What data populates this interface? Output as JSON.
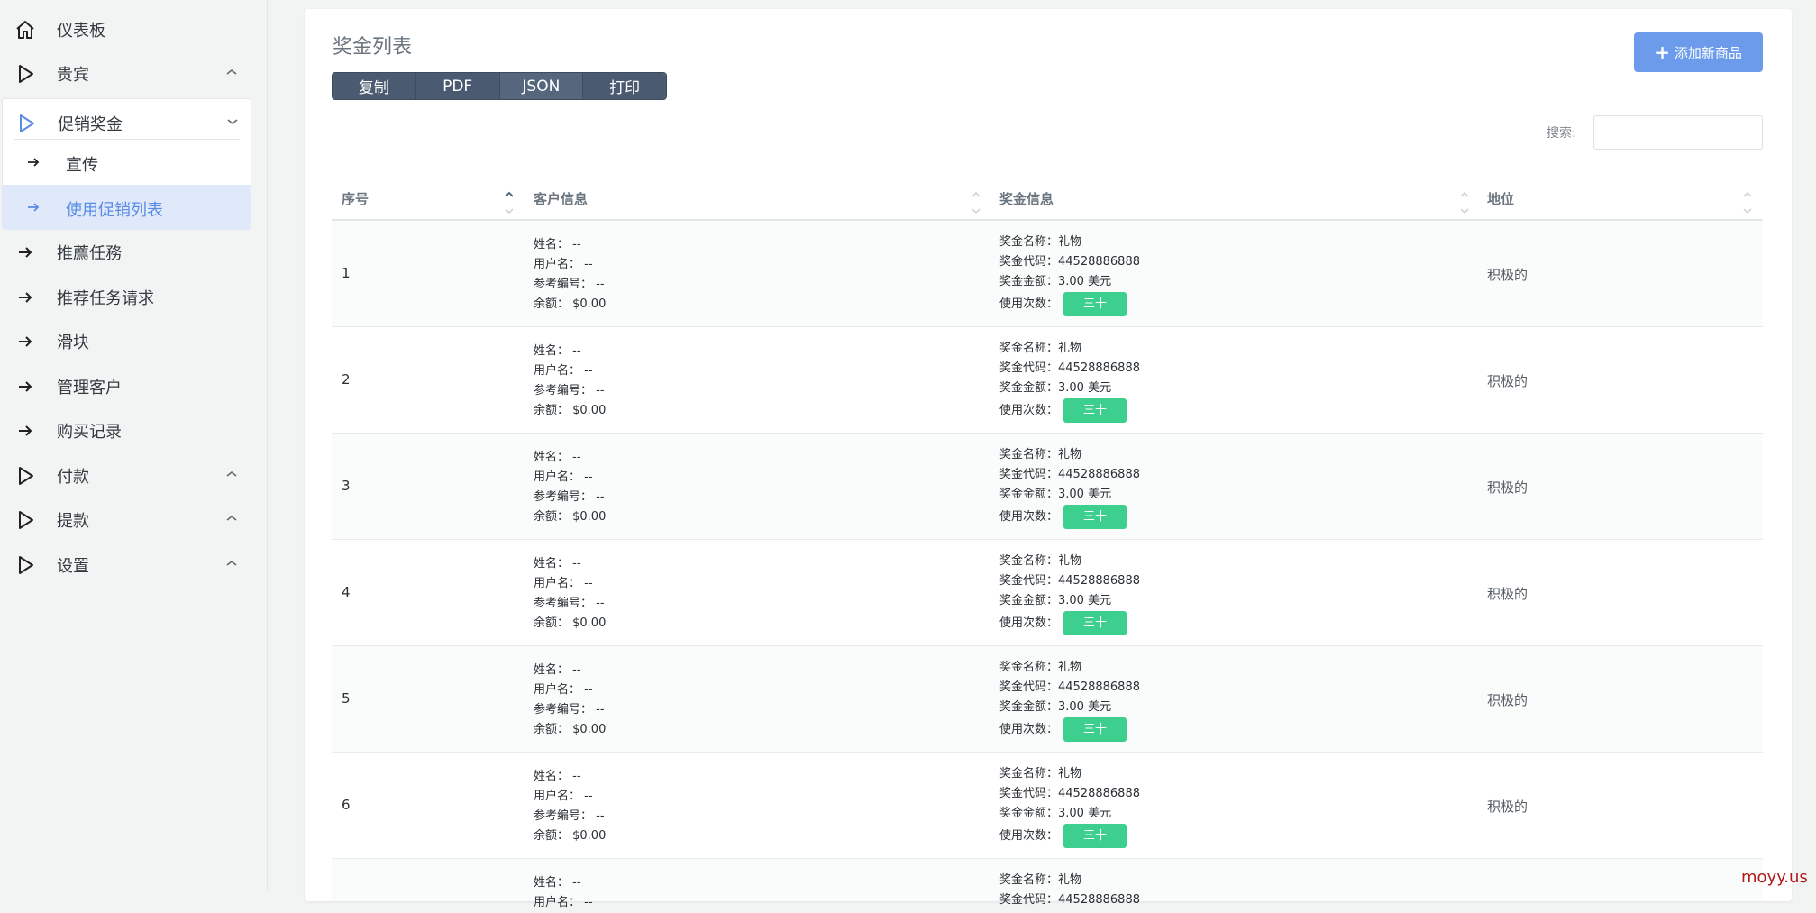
{
  "sidebar": {
    "items": [
      {
        "label": "仪表板",
        "icon": "home-icon"
      },
      {
        "label": "贵宾",
        "icon": "play-icon"
      },
      {
        "label": "促销奖金",
        "icon": "play-icon"
      },
      {
        "label": "推薦任務",
        "icon": "arrow-right-icon"
      },
      {
        "label": "推荐任务请求",
        "icon": "arrow-right-icon"
      },
      {
        "label": "滑块",
        "icon": "arrow-right-icon"
      },
      {
        "label": "管理客户",
        "icon": "arrow-right-icon"
      },
      {
        "label": "购买记录",
        "icon": "arrow-right-icon"
      },
      {
        "label": "付款",
        "icon": "play-icon"
      },
      {
        "label": "提款",
        "icon": "play-icon"
      },
      {
        "label": "设置",
        "icon": "play-icon"
      }
    ],
    "submenu": [
      {
        "label": "宣传"
      },
      {
        "label": "使用促销列表"
      }
    ],
    "accent": "#5a8be6"
  },
  "card": {
    "title": "奖金列表",
    "export_buttons": [
      "复制",
      "PDF",
      "JSON",
      "打印"
    ],
    "add_button": "添加新商品",
    "search_label": "搜索:",
    "search_value": ""
  },
  "table": {
    "headers": [
      "序号",
      "客户信息",
      "奖金信息",
      "地位"
    ],
    "rows": [
      {
        "idx": "1",
        "cust": [
          "姓名： --",
          "用户名： --",
          "参考编号： --",
          "余额： $0.00"
        ],
        "prize": [
          "奖金名称：礼物",
          "奖金代码：44528886888",
          "奖金金额：3.00 美元",
          "使用次数："
        ],
        "usage": "三十",
        "status": "积极的"
      },
      {
        "idx": "2",
        "cust": [
          "姓名： --",
          "用户名： --",
          "参考编号： --",
          "余额： $0.00"
        ],
        "prize": [
          "奖金名称：礼物",
          "奖金代码：44528886888",
          "奖金金额：3.00 美元",
          "使用次数："
        ],
        "usage": "三十",
        "status": "积极的"
      },
      {
        "idx": "3",
        "cust": [
          "姓名： --",
          "用户名： --",
          "参考编号： --",
          "余额： $0.00"
        ],
        "prize": [
          "奖金名称：礼物",
          "奖金代码：44528886888",
          "奖金金额：3.00 美元",
          "使用次数："
        ],
        "usage": "三十",
        "status": "积极的"
      },
      {
        "idx": "4",
        "cust": [
          "姓名： --",
          "用户名： --",
          "参考编号： --",
          "余额： $0.00"
        ],
        "prize": [
          "奖金名称：礼物",
          "奖金代码：44528886888",
          "奖金金额：3.00 美元",
          "使用次数："
        ],
        "usage": "三十",
        "status": "积极的"
      },
      {
        "idx": "5",
        "cust": [
          "姓名： --",
          "用户名： --",
          "参考编号： --",
          "余额： $0.00"
        ],
        "prize": [
          "奖金名称：礼物",
          "奖金代码：44528886888",
          "奖金金额：3.00 美元",
          "使用次数："
        ],
        "usage": "三十",
        "status": "积极的"
      },
      {
        "idx": "6",
        "cust": [
          "姓名： --",
          "用户名： --",
          "参考编号： --",
          "余额： $0.00"
        ],
        "prize": [
          "奖金名称：礼物",
          "奖金代码：44528886888",
          "奖金金额：3.00 美元",
          "使用次数："
        ],
        "usage": "三十",
        "status": "积极的"
      },
      {
        "idx": "",
        "cust": [
          "姓名： --",
          "用户名： --"
        ],
        "prize": [
          "奖金名称：礼物",
          "奖金代码：44528886888"
        ],
        "usage": "",
        "status": ""
      }
    ]
  },
  "watermark": "moyy.us"
}
